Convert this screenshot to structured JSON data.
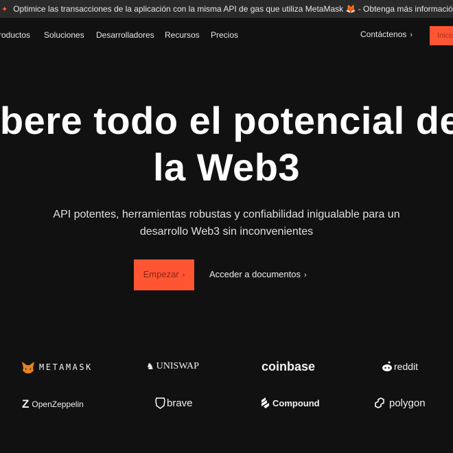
{
  "banner": {
    "text": "Optimice las transacciones de la aplicación con la misma API de gas que utiliza MetaMask 🦊 - Obtenga más información",
    "chevron": "›",
    "icon": "rocket-icon"
  },
  "nav": {
    "items": [
      "roductos",
      "Soluciones",
      "Desarrolladores",
      "Recursos",
      "Precios"
    ],
    "contact": "Contáctenos",
    "chevron": "›",
    "start": "Inicia"
  },
  "hero": {
    "title_line1": "ibere todo el potencial de",
    "title_line2": "la Web3",
    "subtitle_line1": "API potentes, herramientas robustas y confiabilidad inigualable para un",
    "subtitle_line2": "desarrollo Web3 sin inconvenientes",
    "primary": "Empezar",
    "secondary": "Acceder a documentos",
    "chevron": "›"
  },
  "logos": [
    "METAMASK",
    "UNISWAP",
    "coinbase",
    "reddit",
    "OpenZeppelin",
    "brave",
    "Compound",
    "polygon"
  ],
  "colors": {
    "accent": "#ff5533",
    "background": "#111111",
    "banner": "#2a2a2a"
  }
}
